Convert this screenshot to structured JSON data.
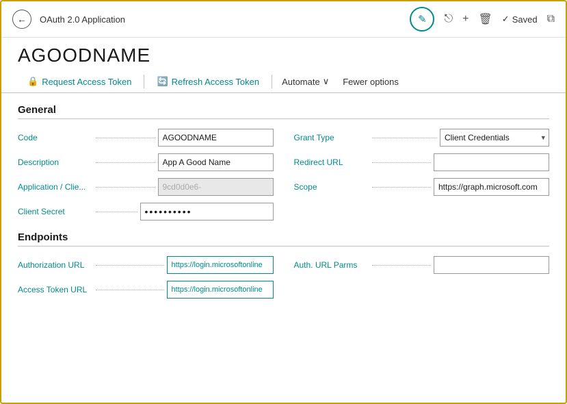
{
  "window": {
    "title": "OAuth 2.0 Application"
  },
  "header": {
    "back_label": "←",
    "title": "OAuth 2.0 Application",
    "edit_icon": "✏",
    "share_icon": "↗",
    "add_icon": "+",
    "delete_icon": "🗑",
    "saved_label": "Saved",
    "check_icon": "✓",
    "expand_icon": "⧉"
  },
  "app": {
    "name": "AGOODNAME"
  },
  "tabs": [
    {
      "id": "request-access-token",
      "label": "Request Access Token",
      "icon": "🔒"
    },
    {
      "id": "refresh-access-token",
      "label": "Refresh Access Token",
      "icon": "🔄"
    },
    {
      "id": "automate",
      "label": "Automate",
      "has_dropdown": true
    },
    {
      "id": "fewer-options",
      "label": "Fewer options"
    }
  ],
  "general": {
    "section_title": "General",
    "fields": {
      "code_label": "Code",
      "code_value": "AGOODNAME",
      "grant_type_label": "Grant Type",
      "grant_type_value": "Client Credentials",
      "description_label": "Description",
      "description_value": "App A Good Name",
      "redirect_url_label": "Redirect URL",
      "redirect_url_value": "",
      "app_client_label": "Application / Clie...",
      "app_client_value": "9cd0d0e6-",
      "scope_label": "Scope",
      "scope_value": "https://graph.microsoft.com",
      "client_secret_label": "Client Secret",
      "client_secret_value": "••••••••••"
    }
  },
  "endpoints": {
    "section_title": "Endpoints",
    "fields": {
      "auth_url_label": "Authorization URL",
      "auth_url_value": "https://login.microsoftonline",
      "auth_url_parms_label": "Auth. URL Parms",
      "auth_url_parms_value": "",
      "access_token_url_label": "Access Token URL",
      "access_token_url_value": "https://login.microsoftonline"
    }
  },
  "icons": {
    "lock": "🔒",
    "refresh": "🔄",
    "chevron_down": "∨",
    "check": "✓",
    "edit": "✎",
    "back": "←",
    "share": "⎋",
    "add": "+",
    "delete": "⧠",
    "expand": "⧉"
  }
}
